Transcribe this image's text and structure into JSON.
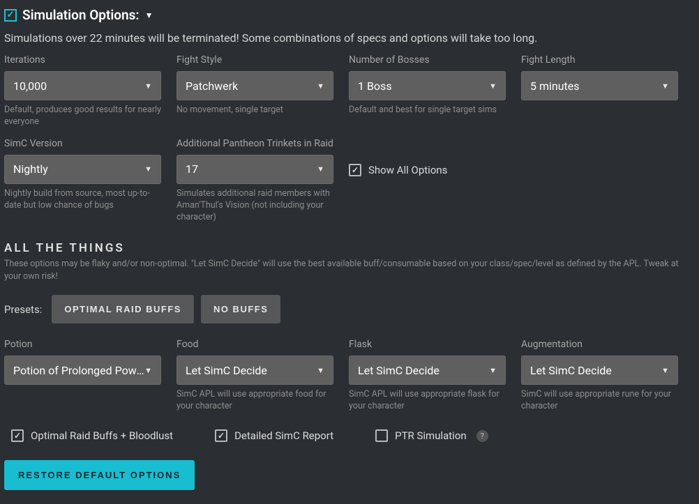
{
  "header": {
    "title": "Simulation Options:",
    "warning": "Simulations over 22 minutes will be terminated! Some combinations of specs and options will take too long."
  },
  "fields": {
    "iterations": {
      "label": "Iterations",
      "value": "10,000",
      "help": "Default, produces good results for nearly everyone"
    },
    "fight_style": {
      "label": "Fight Style",
      "value": "Patchwerk",
      "help": "No movement, single target"
    },
    "num_bosses": {
      "label": "Number of Bosses",
      "value": "1 Boss",
      "help": "Default and best for single target sims"
    },
    "fight_length": {
      "label": "Fight Length",
      "value": "5 minutes",
      "help": ""
    },
    "simc_version": {
      "label": "SimC Version",
      "value": "Nightly",
      "help": "Nightly build from source, most up-to-date but low chance of bugs"
    },
    "pantheon": {
      "label": "Additional Pantheon Trinkets in Raid",
      "value": "17",
      "help": "Simulates additional raid members with Aman'Thul's Vision (not including your character)"
    },
    "show_all": {
      "label": "Show All Options"
    }
  },
  "all_things": {
    "heading": "ALL THE THINGS",
    "sub": "These options may be flaky and/or non-optimal. \"Let SimC Decide\" will use the best available buff/consumable based on your class/spec/level as defined by the APL. Tweak at your own risk!",
    "presets_label": "Presets:",
    "preset_optimal": "OPTIMAL RAID BUFFS",
    "preset_none": "NO BUFFS"
  },
  "consumables": {
    "potion": {
      "label": "Potion",
      "value": "Potion of Prolonged Power",
      "help": ""
    },
    "food": {
      "label": "Food",
      "value": "Let SimC Decide",
      "help": "SimC APL will use appropriate food for your character"
    },
    "flask": {
      "label": "Flask",
      "value": "Let SimC Decide",
      "help": "SimC APL will use appropriate flask for your character"
    },
    "augmentation": {
      "label": "Augmentation",
      "value": "Let SimC Decide",
      "help": "SimC will use appropriate rune for your character"
    }
  },
  "checks": {
    "optimal_buffs": "Optimal Raid Buffs + Bloodlust",
    "detailed_report": "Detailed SimC Report",
    "ptr_sim": "PTR Simulation"
  },
  "restore_btn": "RESTORE DEFAULT OPTIONS"
}
